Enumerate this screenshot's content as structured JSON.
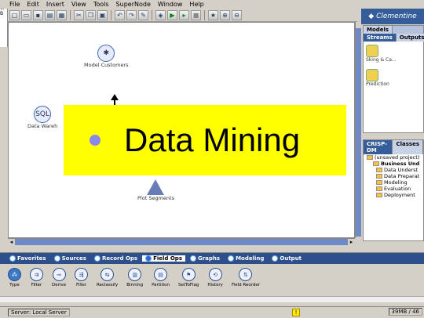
{
  "menu": [
    "File",
    "Edit",
    "Insert",
    "View",
    "Tools",
    "SuperNode",
    "Window",
    "Help"
  ],
  "brand": "Clementine",
  "canvas_nodes": {
    "model_customers": "Model Customers",
    "data_warehouse": "Data Wareh",
    "plot_segments": "Plot Segments"
  },
  "overlay": {
    "title": "Data Mining",
    "bullet_color": "#8888ee",
    "background": "#ffff00"
  },
  "models_panel": {
    "tabs": [
      "Models",
      "Streams",
      "Outputs"
    ],
    "items": [
      "Sking & Ca...",
      "Prediction"
    ]
  },
  "crisp_panel": {
    "tabs": [
      "CRISP-DM",
      "Classes"
    ],
    "project": "(unsaved project)",
    "items": [
      "Business Und",
      "Data Underst",
      "Data Preparat",
      "Modeling",
      "Evaluation",
      "Deployment"
    ]
  },
  "palette": {
    "tabs": [
      {
        "label": "Favorites",
        "icon": "favorites-icon"
      },
      {
        "label": "Sources",
        "icon": "sources-icon"
      },
      {
        "label": "Record Ops",
        "icon": "record-ops-icon"
      },
      {
        "label": "Field Ops",
        "icon": "field-ops-icon"
      },
      {
        "label": "Graphs",
        "icon": "graphs-icon"
      },
      {
        "label": "Modeling",
        "icon": "modeling-icon"
      },
      {
        "label": "Output",
        "icon": "output-icon"
      }
    ],
    "nodes": [
      "Type",
      "Filter",
      "Derive",
      "Filler",
      "Reclassify",
      "Binning",
      "Partition",
      "SetToFlag",
      "History",
      "Field Reorder"
    ]
  },
  "status": {
    "server": "Server: Local Server",
    "memory": "39MB / 46"
  },
  "colors": {
    "accent": "#345d9a",
    "scrollbar": "#6f89c7"
  }
}
